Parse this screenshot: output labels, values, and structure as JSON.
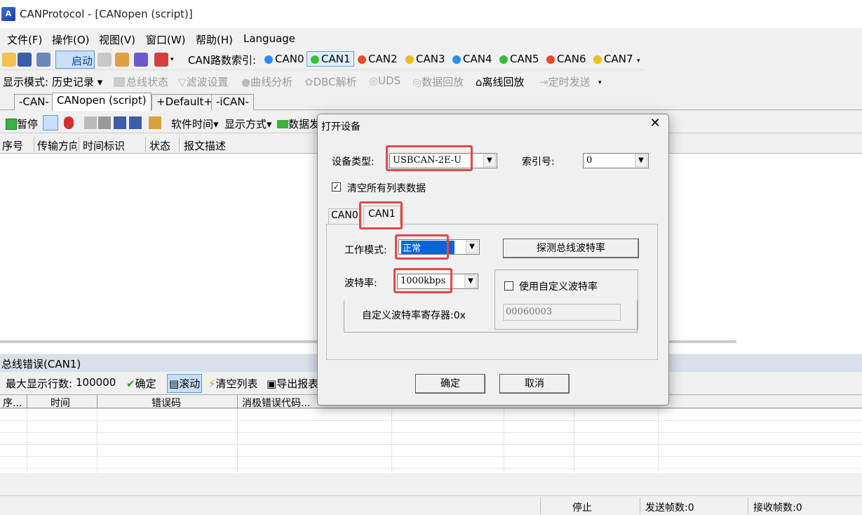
{
  "window": {
    "title": "CANProtocol - [CANopen (script)]",
    "icon": "app-icon"
  },
  "menu": [
    "文件(F)",
    "操作(O)",
    "视图(V)",
    "窗口(W)",
    "帮助(H)",
    "Language"
  ],
  "toolbar1": {
    "start_label": "启动",
    "can_index_label": "CAN路数索引:",
    "channels": [
      {
        "label": "CAN0",
        "color": "#2a8ee8"
      },
      {
        "label": "CAN1",
        "color": "#38c038"
      },
      {
        "label": "CAN2",
        "color": "#e84a2a"
      },
      {
        "label": "CAN3",
        "color": "#e8c020"
      },
      {
        "label": "CAN4",
        "color": "#2a8ee8"
      },
      {
        "label": "CAN5",
        "color": "#38c038"
      },
      {
        "label": "CAN6",
        "color": "#e84a2a"
      },
      {
        "label": "CAN7",
        "color": "#e8c020"
      }
    ]
  },
  "toolbar2": {
    "display_mode_label": "显示模式:",
    "display_mode_value": "历史记录",
    "items": [
      "总线状态",
      "滤波设置",
      "曲线分析",
      "DBC解析",
      "UDS",
      "数据回放",
      "离线回放",
      "定时发送"
    ]
  },
  "tabs": [
    "-CAN-",
    "CANopen (script)",
    "+Default+",
    "-iCAN-"
  ],
  "toolbar3": {
    "pause": "暂停",
    "software_time": "软件时间",
    "display_method": "显示方式",
    "data_prefix": "数据发"
  },
  "grid_columns": [
    "序号",
    "传输方向",
    "时间标识",
    "状态",
    "报文描述"
  ],
  "bus_error": {
    "title": "总线错误(CAN1)",
    "max_rows_label": "最大显示行数:",
    "max_rows_value": "100000",
    "confirm": "确定",
    "scroll": "滚动",
    "clear_list": "清空列表",
    "export_report": "导出报表",
    "columns": [
      "序...",
      "时间",
      "错误码",
      "消极错误代码..."
    ]
  },
  "status_bar": {
    "state": "停止",
    "sent": "发送帧数:0",
    "received": "接收帧数:0"
  },
  "dialog": {
    "title": "打开设备",
    "device_type_label": "设备类型:",
    "device_type_value": "USBCAN-2E-U",
    "index_label": "索引号:",
    "index_value": "0",
    "clear_checkbox_label": "清空所有列表数据",
    "clear_checked": true,
    "channel_tabs": [
      "CAN0",
      "CAN1"
    ],
    "work_mode_label": "工作模式:",
    "work_mode_value": "正常",
    "detect_button": "探测总线波特率",
    "baud_label": "波特率:",
    "baud_value": "1000kbps",
    "custom_baud_label": "使用自定义波特率",
    "custom_reg_label": "自定义波特率寄存器:0x",
    "custom_reg_value": "00060003",
    "ok": "确定",
    "cancel": "取消",
    "highlight_color": "#e04848"
  }
}
